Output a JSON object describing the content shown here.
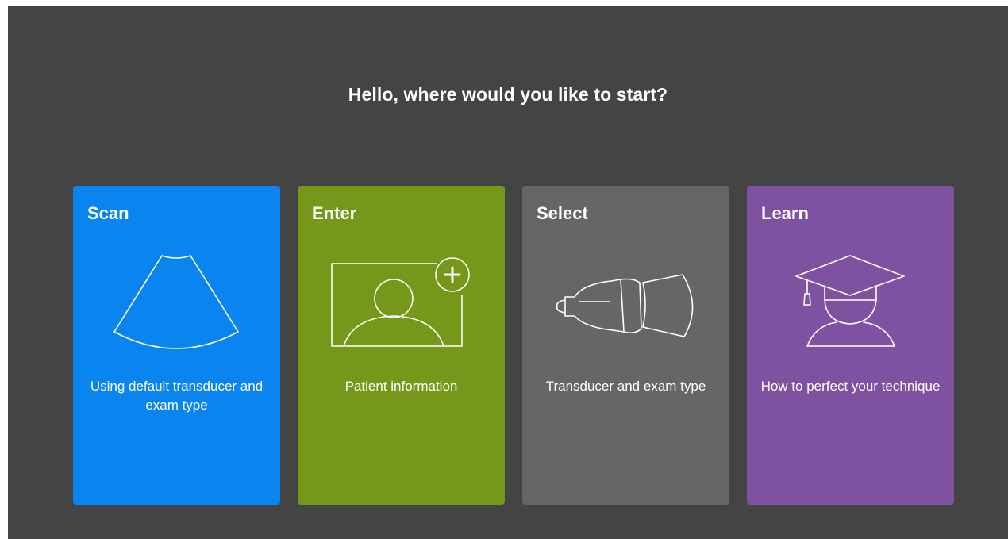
{
  "header": {
    "title": "Hello, where would you like to start?"
  },
  "cards": [
    {
      "title": "Scan",
      "description": "Using default transducer and exam type",
      "color": "#0A84EE",
      "icon": "ultrasound-fan-icon"
    },
    {
      "title": "Enter",
      "description": "Patient information",
      "color": "#76981A",
      "icon": "add-patient-icon"
    },
    {
      "title": "Select",
      "description": "Transducer and exam type",
      "color": "#666666",
      "icon": "transducer-probe-icon"
    },
    {
      "title": "Learn",
      "description": "How to perfect your technique",
      "color": "#7F52A1",
      "icon": "graduation-cap-icon"
    }
  ],
  "colors": {
    "background": "#444444",
    "text": "#FFFFFF"
  }
}
